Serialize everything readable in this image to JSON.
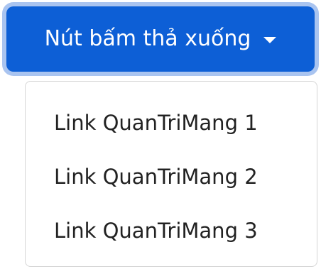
{
  "dropdown": {
    "button_label": "Nút bấm thả xuống",
    "caret_icon": "caret-down-icon",
    "items": [
      {
        "label": "Link QuanTriMang 1"
      },
      {
        "label": "Link QuanTriMang 2"
      },
      {
        "label": "Link QuanTriMang 3"
      }
    ]
  },
  "colors": {
    "button_background": "#0d5fd6",
    "button_focus_ring": "#a9c4f0",
    "button_text": "#ffffff",
    "menu_border": "#d6d6d6",
    "item_text": "#222222"
  }
}
